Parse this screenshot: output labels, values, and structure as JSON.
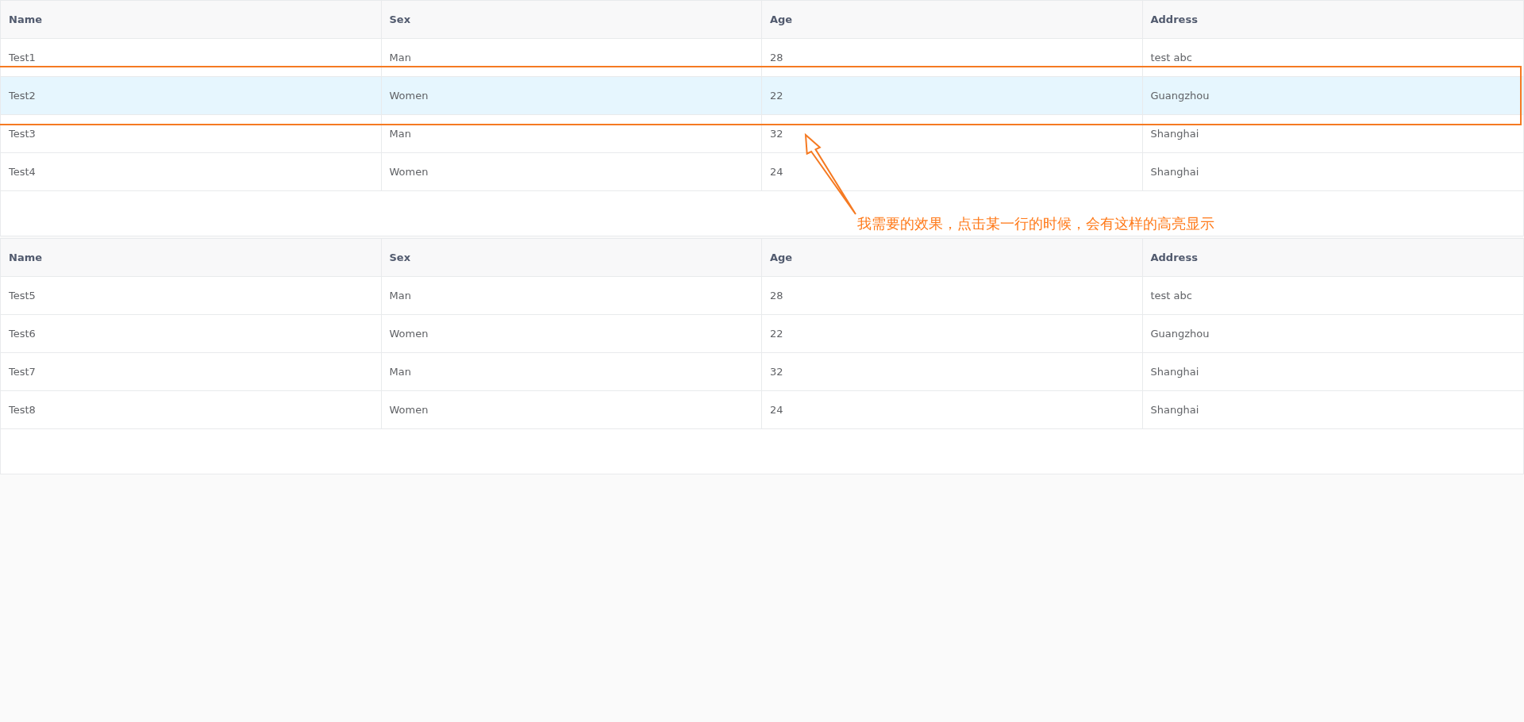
{
  "tables": [
    {
      "columns": [
        "Name",
        "Sex",
        "Age",
        "Address"
      ],
      "rows": [
        {
          "cells": [
            "Test1",
            "Man",
            "28",
            "test abc"
          ],
          "selected": false
        },
        {
          "cells": [
            "Test2",
            "Women",
            "22",
            "Guangzhou"
          ],
          "selected": true
        },
        {
          "cells": [
            "Test3",
            "Man",
            "32",
            "Shanghai"
          ],
          "selected": false
        },
        {
          "cells": [
            "Test4",
            "Women",
            "24",
            "Shanghai"
          ],
          "selected": false
        }
      ]
    },
    {
      "columns": [
        "Name",
        "Sex",
        "Age",
        "Address"
      ],
      "rows": [
        {
          "cells": [
            "Test5",
            "Man",
            "28",
            "test abc"
          ],
          "selected": false
        },
        {
          "cells": [
            "Test6",
            "Women",
            "22",
            "Guangzhou"
          ],
          "selected": false
        },
        {
          "cells": [
            "Test7",
            "Man",
            "32",
            "Shanghai"
          ],
          "selected": false
        },
        {
          "cells": [
            "Test8",
            "Women",
            "24",
            "Shanghai"
          ],
          "selected": false
        }
      ]
    }
  ],
  "annotation": {
    "text": "我需要的效果，点击某一行的时候，会有这样的高亮显示"
  }
}
